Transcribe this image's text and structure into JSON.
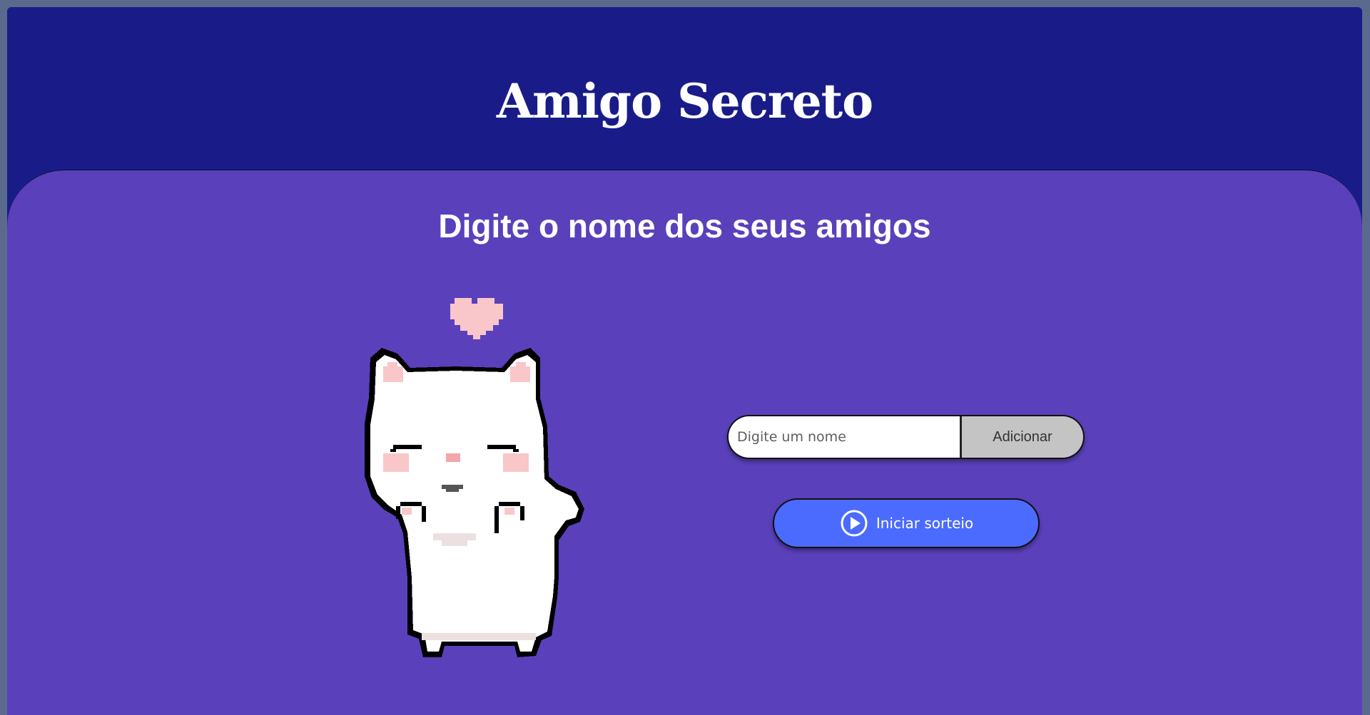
{
  "header": {
    "title": "Amigo Secreto"
  },
  "main": {
    "subtitle": "Digite o nome dos seus amigos",
    "illustration": "pixel-cat-with-heart",
    "name_input": {
      "value": "",
      "placeholder": "Digite um nome"
    },
    "add_button_label": "Adicionar",
    "draw_button": {
      "label": "Iniciar sorteio",
      "icon": "play-circle-icon"
    }
  },
  "colors": {
    "header_bg": "#191c88",
    "card_bg": "#5a41bb",
    "draw_button_bg": "#4b6bff",
    "add_button_bg": "#c4c4c4"
  }
}
